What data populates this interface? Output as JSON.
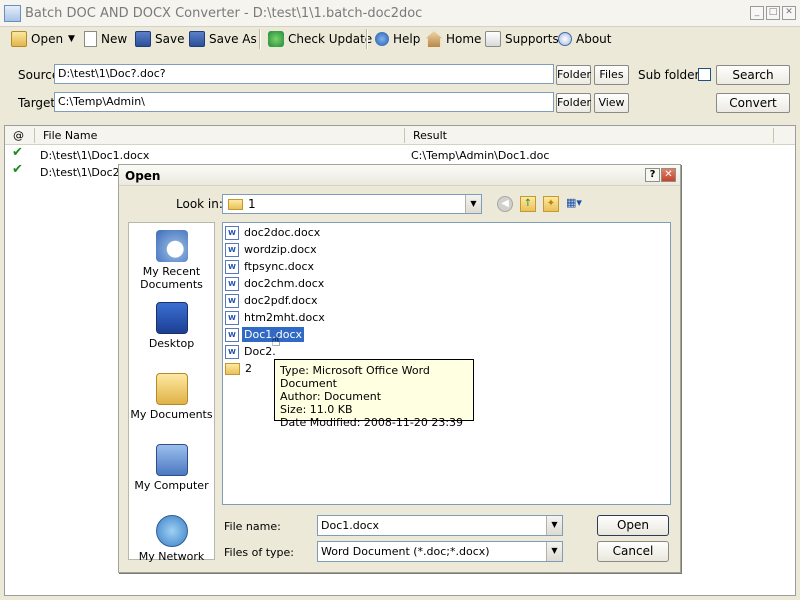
{
  "window": {
    "title": "Batch DOC AND DOCX Converter - D:\\test\\1\\1.batch-doc2doc"
  },
  "toolbar": {
    "open": "Open",
    "new": "New",
    "save": "Save",
    "save_as": "Save As",
    "check_update": "Check Update",
    "help": "Help",
    "home": "Home",
    "supports": "Supports",
    "about": "About"
  },
  "form": {
    "source_label": "Source",
    "source_value": "D:\\test\\1\\Doc?.doc?",
    "target_label": "Target",
    "target_value": "C:\\Temp\\Admin\\",
    "folder": "Folder",
    "files": "Files",
    "view": "View",
    "subfolders": "Sub folders",
    "search": "Search",
    "convert": "Convert"
  },
  "list": {
    "headers": {
      "status": "@",
      "file_name": "File Name",
      "result": "Result"
    },
    "rows": [
      {
        "file": "D:\\test\\1\\Doc1.docx",
        "result": "C:\\Temp\\Admin\\Doc1.doc"
      },
      {
        "file": "D:\\test\\1\\Doc2.",
        "result": ""
      }
    ]
  },
  "dialog": {
    "title": "Open",
    "look_in_label": "Look in:",
    "look_in_value": "1",
    "places": [
      "My Recent Documents",
      "Desktop",
      "My Documents",
      "My Computer",
      "My Network"
    ],
    "files": [
      "doc2doc.docx",
      "wordzip.docx",
      "ftpsync.docx",
      "doc2chm.docx",
      "doc2pdf.docx",
      "htm2mht.docx",
      "Doc1.docx",
      "Doc2.",
      "2"
    ],
    "tooltip": {
      "type": "Type: Microsoft Office Word Document",
      "author": "Author:  Document",
      "size": "Size: 11.0 KB",
      "modified": "Date Modified: 2008-11-20 23:39"
    },
    "file_name_label": "File name:",
    "file_name_value": "Doc1.docx",
    "files_of_type_label": "Files of type:",
    "files_of_type_value": "Word Document (*.doc;*.docx)",
    "open_button": "Open",
    "cancel_button": "Cancel"
  }
}
